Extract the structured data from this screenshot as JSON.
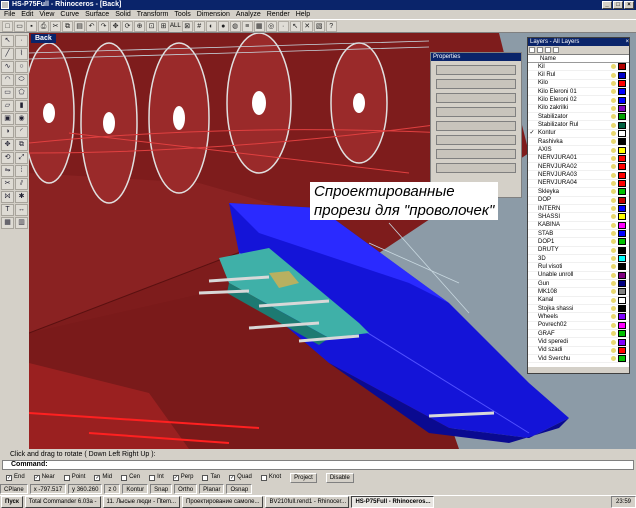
{
  "window": {
    "title": "HS-P75Full - Rhinoceros - [Back]",
    "min": "_",
    "max": "□",
    "close": "×"
  },
  "menu": [
    "File",
    "Edit",
    "View",
    "Curve",
    "Surface",
    "Solid",
    "Transform",
    "Tools",
    "Dimension",
    "Analyze",
    "Render",
    "Help"
  ],
  "toolbar_icons": [
    "new",
    "open",
    "save",
    "print",
    "cut",
    "copy",
    "paste",
    "undo",
    "redo",
    "pan",
    "rotate",
    "zoom",
    "zoom-window",
    "zoom-extents",
    "zoom-all",
    "grid",
    "shade",
    "render",
    "color",
    "layer",
    "properties",
    "osnap",
    "point",
    "select",
    "delete",
    "mesh",
    "help"
  ],
  "toolbar_all_label": "ALL",
  "left_tools": [
    "select",
    "point",
    "line",
    "polyline",
    "curve",
    "circle",
    "arc",
    "ellipse",
    "rectangle",
    "polygon",
    "surface",
    "extrude",
    "box",
    "sphere",
    "boolean",
    "fillet",
    "move",
    "copy",
    "rotate",
    "scale",
    "mirror",
    "array",
    "trim",
    "split",
    "join",
    "explode",
    "text",
    "dim",
    "group",
    "ungroup"
  ],
  "viewport": {
    "label": "Back"
  },
  "annotation": {
    "line1": "Спроектированные",
    "line2": "прорези для \"проволочек\""
  },
  "properties_panel": {
    "title": "Properties"
  },
  "layers_panel": {
    "title": "Layers - All Layers",
    "close": "×",
    "column_name": "Name",
    "layers": [
      {
        "name": "Kil",
        "color": "#b00000",
        "checked": ""
      },
      {
        "name": "Kil Rul",
        "color": "#0000c8",
        "checked": ""
      },
      {
        "name": "Kilo",
        "color": "#ff0000",
        "checked": ""
      },
      {
        "name": "Kilo Eleroni 01",
        "color": "#0000ff",
        "checked": ""
      },
      {
        "name": "Kilo Eleroni 02",
        "color": "#0000ff",
        "checked": ""
      },
      {
        "name": "Kilo zakrilki",
        "color": "#8000c0",
        "checked": ""
      },
      {
        "name": "Stabilizator",
        "color": "#00a000",
        "checked": ""
      },
      {
        "name": "Stabilizator Rul",
        "color": "#006040",
        "checked": ""
      },
      {
        "name": "Kontur",
        "color": "#ffffff",
        "checked": "✓"
      },
      {
        "name": "Rashivka",
        "color": "#000000",
        "checked": ""
      },
      {
        "name": "AXIS",
        "color": "#ffff00",
        "checked": ""
      },
      {
        "name": "NERVJURA01",
        "color": "#ff0000",
        "checked": ""
      },
      {
        "name": "NERVJURA02",
        "color": "#ff0000",
        "checked": ""
      },
      {
        "name": "NERVJURA03",
        "color": "#ff0000",
        "checked": ""
      },
      {
        "name": "NERVJURA04",
        "color": "#ff0000",
        "checked": ""
      },
      {
        "name": "Skleyka",
        "color": "#00c000",
        "checked": ""
      },
      {
        "name": "DOP",
        "color": "#c00000",
        "checked": ""
      },
      {
        "name": "INTERN",
        "color": "#0000ff",
        "checked": ""
      },
      {
        "name": "SHASSI",
        "color": "#ffff00",
        "checked": ""
      },
      {
        "name": "KABINA",
        "color": "#ff00ff",
        "checked": ""
      },
      {
        "name": "STAB",
        "color": "#0000ff",
        "checked": ""
      },
      {
        "name": "DOP1",
        "color": "#00c000",
        "checked": ""
      },
      {
        "name": "DRUTY",
        "color": "#000000",
        "checked": ""
      },
      {
        "name": "3D",
        "color": "#00ffff",
        "checked": ""
      },
      {
        "name": "Rul visoti",
        "color": "#000000",
        "checked": ""
      },
      {
        "name": "Unable unroll",
        "color": "#800080",
        "checked": ""
      },
      {
        "name": "Gun",
        "color": "#000080",
        "checked": ""
      },
      {
        "name": "MK108",
        "color": "#808080",
        "checked": ""
      },
      {
        "name": "Kanal",
        "color": "#ffffff",
        "checked": ""
      },
      {
        "name": "Stojka shassi",
        "color": "#000000",
        "checked": ""
      },
      {
        "name": "Wheels",
        "color": "#8000ff",
        "checked": ""
      },
      {
        "name": "Povrech02",
        "color": "#ff00ff",
        "checked": ""
      },
      {
        "name": "GRAF",
        "color": "#00c000",
        "checked": ""
      },
      {
        "name": "Vid speredi",
        "color": "#8000ff",
        "checked": ""
      },
      {
        "name": "Vid szadi",
        "color": "#ff0000",
        "checked": ""
      },
      {
        "name": "Vid Sverchu",
        "color": "#00c000",
        "checked": ""
      }
    ]
  },
  "command": {
    "prompt": "Click and drag to rotate ( Down  Left  Right  Up ):",
    "label": "Command:"
  },
  "osnaps": [
    {
      "label": "End",
      "on": true
    },
    {
      "label": "Near",
      "on": true
    },
    {
      "label": "Point",
      "on": false
    },
    {
      "label": "Mid",
      "on": true
    },
    {
      "label": "Cen",
      "on": false
    },
    {
      "label": "Int",
      "on": false
    },
    {
      "label": "Perp",
      "on": true
    },
    {
      "label": "Tan",
      "on": false
    },
    {
      "label": "Quad",
      "on": true
    },
    {
      "label": "Knot",
      "on": false
    }
  ],
  "osnap_buttons": [
    "Project",
    "Disable"
  ],
  "status": {
    "cplane": "CPlane",
    "x": "x -797.517",
    "y": "y 360.260",
    "z": "z 0",
    "layer": "Kontur",
    "snap": "Snap",
    "ortho": "Ortho",
    "planar": "Planar",
    "osnap": "Osnap"
  },
  "taskbar": {
    "start": "Пуск",
    "tasks": [
      "Total Commander 6.03a -",
      "11. Лысые люди - Пtem...",
      "Проектирование самоле...",
      "BV210full.rend1 - Rhinocer...",
      "HS-P75Full - Rhinoceros..."
    ],
    "clock": "23:59"
  }
}
